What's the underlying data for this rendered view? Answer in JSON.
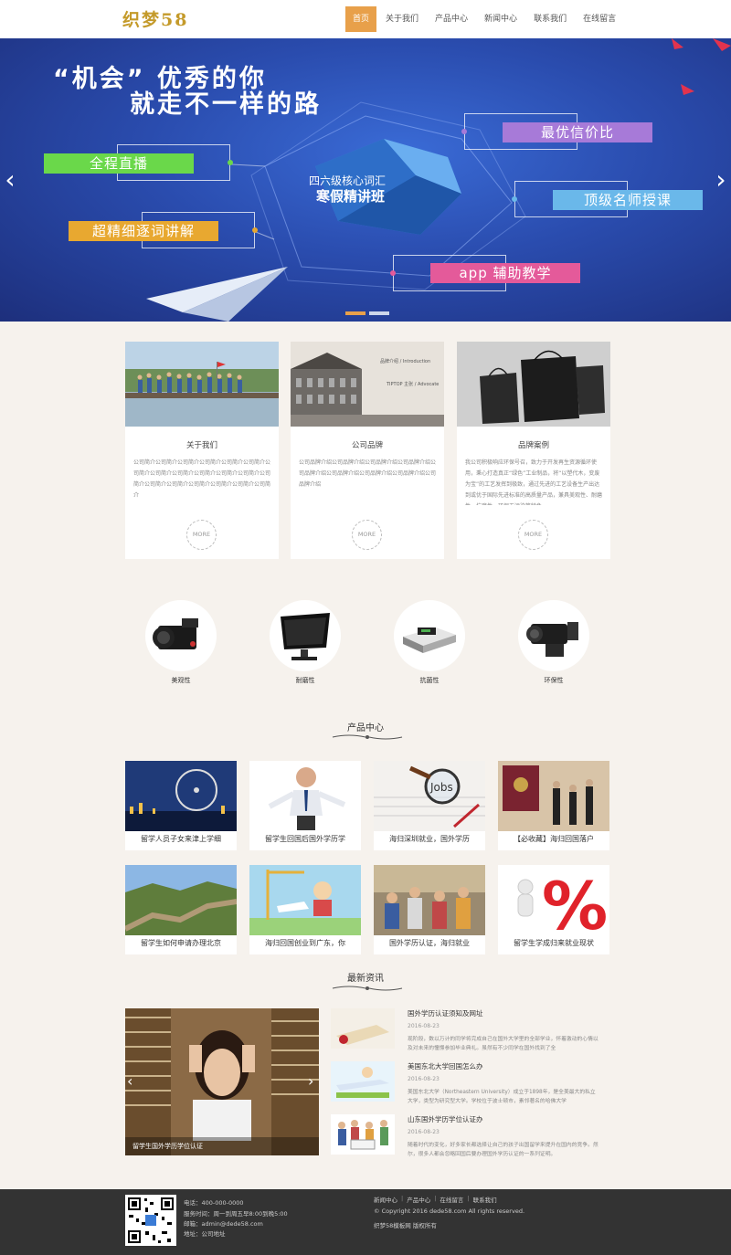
{
  "header": {
    "logo": "织梦58",
    "nav": [
      "首页",
      "关于我们",
      "产品中心",
      "新闻中心",
      "联系我们",
      "在线留言"
    ]
  },
  "banner": {
    "title_line1": "“机会” 优秀的你",
    "title_line2": "就走不一样的路",
    "tags": [
      "全程直播",
      "超精细逐词讲解",
      "最优信价比",
      "顶级名师授课",
      "app 辅助教学"
    ],
    "center_line1": "四六级核心词汇",
    "center_line2": "寒假精讲班",
    "prev_arrow": "‹",
    "next_arrow": "›"
  },
  "cards": [
    {
      "title": "关于我们",
      "text": "公司简介公司简介公司简介公司简介公司简介公司简介公司简介公司简介公司简介公司简介公司简介公司简介公司简介公司简介公司简介公司简介公司简介公司简介公司简介",
      "more": "MORE"
    },
    {
      "title": "公司品牌",
      "text": "公司品牌介绍公司品牌介绍公司品牌介绍公司品牌介绍公司品牌介绍公司品牌介绍公司品牌介绍公司品牌介绍公司品牌介绍",
      "more": "MORE",
      "img_heading": "品牌介绍 / Introduction",
      "img_sub": "TIPTOP 主张 / Advocate"
    },
    {
      "title": "品牌案例",
      "text": "我公司积极响应环保号召，致力于开发再生资源循环使用，秉心打造真正“绿色”工业制品，将“以塑代木，变废为宝”的工艺发挥到极致，通过先进的工艺设备生产出达到或优于国际先进标准的高质量产品，兼具美观性、耐磨性、抗腐性、环保无污染等特色。",
      "more": "MORE"
    }
  ],
  "features": [
    "美观性",
    "耐磨性",
    "抗菌性",
    "环保性"
  ],
  "products": {
    "title": "产品中心",
    "items": [
      "留学人员子女来津上学细",
      "留学生回国后国外学历学",
      "海归深圳就业，国外学历",
      "【必收藏】海归回国落户",
      "留学生如何申请办理北京",
      "海归回国创业到广东，你",
      "国外学历认证，海归就业",
      "留学生学成归来就业现状"
    ]
  },
  "news": {
    "title": "最新资讯",
    "big_caption": "留学生国外学历学位认证",
    "items": [
      {
        "title": "国外学历认证须知及网址",
        "date": "2016-08-23",
        "text": "现阶段，数以万计的同学将完成自己在国外大学里的全部学业，怀着激动的心情以及对未来的憧憬参加毕业典礼。虽然有不少同学在国外找到了全"
      },
      {
        "title": "美国东北大学回国怎么办",
        "date": "2016-08-23",
        "text": "美国东北大学（Northeastern University）成立于1898年，是全美最大的私立大学，类型为研究型大学。学校位于波士顿市，素邻著名的哈佛大学"
      },
      {
        "title": "山东国外学历学位认证办",
        "date": "2016-08-23",
        "text": "随着时代的变化，好多家长都选择让自己的孩子出国留学来提升在国内的竞争。然尔，很多人都会忽略回国后要办理国外学历认证的一系列证明。"
      }
    ]
  },
  "footer": {
    "phone": "电话：400-000-0000",
    "hours": "服务时间：周一到周五早8:00到晚5:00",
    "email": "邮箱：admin@dede58.com",
    "address": "地址：公司地址",
    "links": [
      "新闻中心",
      "产品中心",
      "在线留言",
      "联系我们"
    ],
    "copyright": "© Copyright 2016 dede58.com All rights reserved.",
    "template": "织梦58模板网 版权所有"
  },
  "colors": {
    "accent": "#e8a04a",
    "banner": "#2a4cae",
    "footer": "#333333"
  }
}
